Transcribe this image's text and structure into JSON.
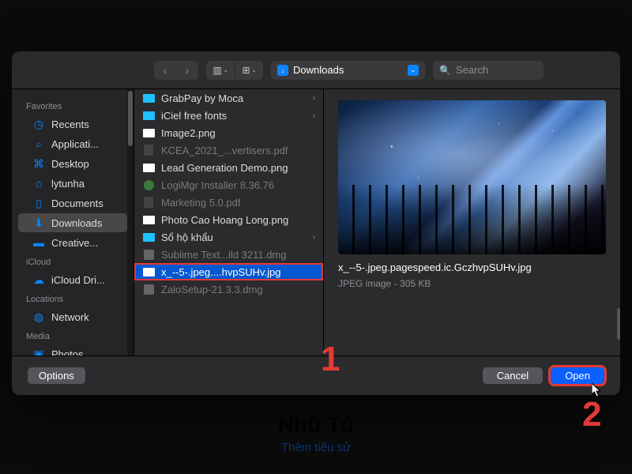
{
  "background": {
    "name": "Nhũ Tú",
    "sub": "Thêm tiểu sử"
  },
  "toolbar": {
    "location": "Downloads",
    "search_placeholder": "Search"
  },
  "sidebar": {
    "sections": [
      {
        "header": "Favorites",
        "items": [
          {
            "label": "Recents",
            "icon": "clock"
          },
          {
            "label": "Applicati...",
            "icon": "apps"
          },
          {
            "label": "Desktop",
            "icon": "desktop"
          },
          {
            "label": "lytunha",
            "icon": "house"
          },
          {
            "label": "Documents",
            "icon": "doc"
          },
          {
            "label": "Downloads",
            "icon": "down",
            "selected": true
          },
          {
            "label": "Creative...",
            "icon": "folder"
          }
        ]
      },
      {
        "header": "iCloud",
        "items": [
          {
            "label": "iCloud Dri...",
            "icon": "cloud"
          }
        ]
      },
      {
        "header": "Locations",
        "items": [
          {
            "label": "Network",
            "icon": "globe"
          }
        ]
      },
      {
        "header": "Media",
        "items": [
          {
            "label": "Photos",
            "icon": "photo"
          }
        ]
      }
    ]
  },
  "files": [
    {
      "name": "GrabPay by Moca",
      "type": "folder",
      "arrow": true
    },
    {
      "name": "iCiel free fonts",
      "type": "folder",
      "arrow": true
    },
    {
      "name": "Image2.png",
      "type": "img"
    },
    {
      "name": "KCEA_2021_...vertisers.pdf",
      "type": "pdf",
      "dim": true
    },
    {
      "name": "Lead Generation Demo.png",
      "type": "img"
    },
    {
      "name": "LogiMgr Installer 8.36.76",
      "type": "app",
      "dim": true
    },
    {
      "name": "Marketing 5.0.pdf",
      "type": "pdf",
      "dim": true
    },
    {
      "name": "Photo Cao Hoang Long.png",
      "type": "img"
    },
    {
      "name": "Sổ hộ khẩu",
      "type": "folder",
      "arrow": true
    },
    {
      "name": "Sublime Text...ild 3211.dmg",
      "type": "dmg",
      "dim": true
    },
    {
      "name": "x_--5-.jpeg....hvpSUHv.jpg",
      "type": "img",
      "selected": true,
      "highlight": true
    },
    {
      "name": "ZaloSetup-21.3.3.dmg",
      "type": "dmg",
      "dim": true
    }
  ],
  "preview": {
    "filename": "x_--5-.jpeg.pagespeed.ic.GczhvpSUHv.jpg",
    "meta": "JPEG image - 305 KB"
  },
  "footer": {
    "options": "Options",
    "cancel": "Cancel",
    "open": "Open"
  },
  "annotations": {
    "a1": "1",
    "a2": "2"
  }
}
